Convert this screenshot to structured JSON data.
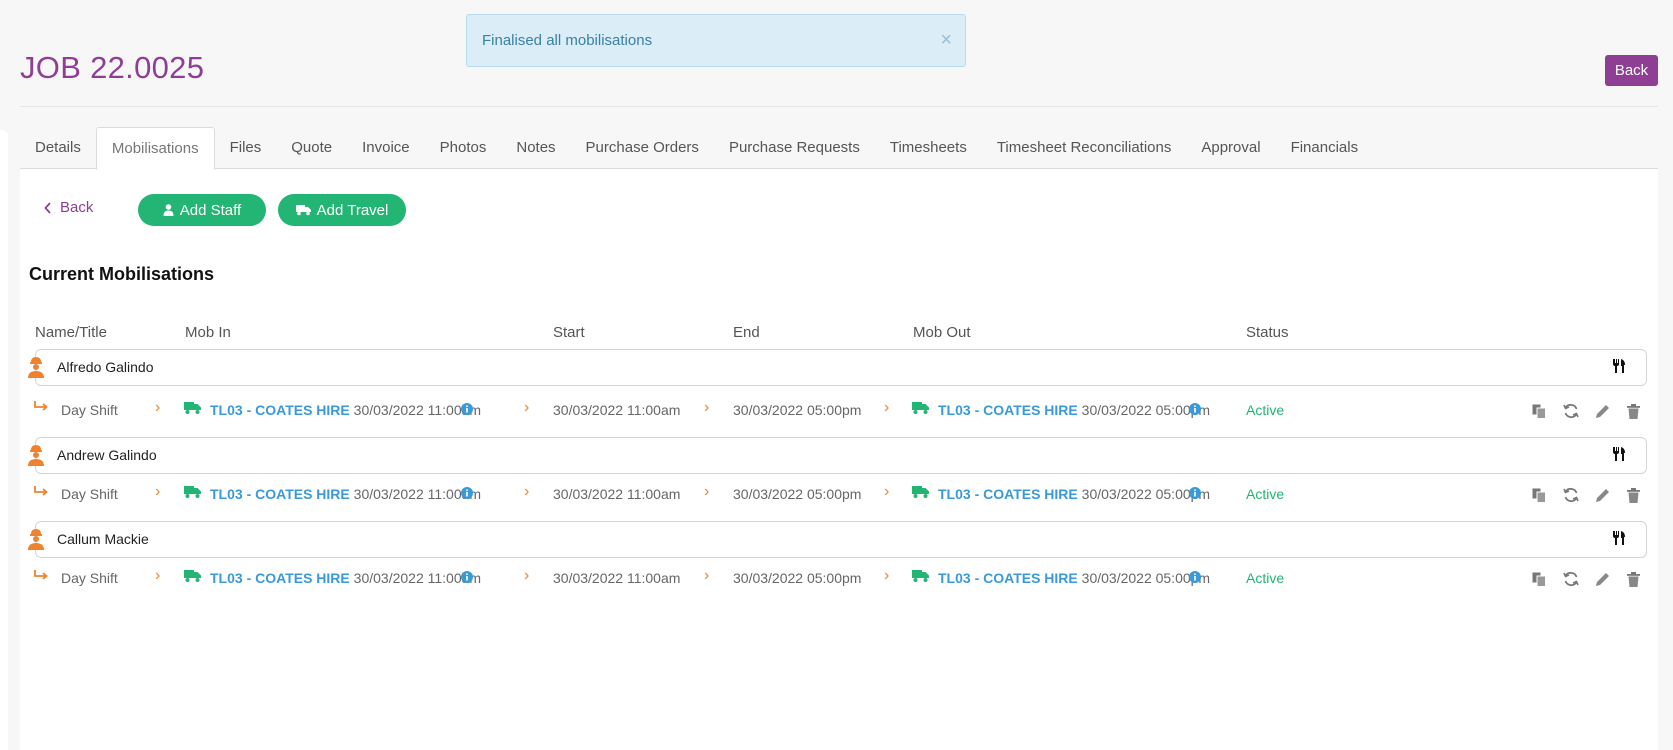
{
  "alert": {
    "message": "Finalised all mobilisations",
    "close": "×"
  },
  "header": {
    "job_title": "JOB 22.0025",
    "back_label": "Back"
  },
  "tabs": [
    "Details",
    "Mobilisations",
    "Files",
    "Quote",
    "Invoice",
    "Photos",
    "Notes",
    "Purchase Orders",
    "Purchase Requests",
    "Timesheets",
    "Timesheet Reconciliations",
    "Approval",
    "Financials"
  ],
  "active_tab": "Mobilisations",
  "toolbar": {
    "back_label": "Back",
    "add_staff_label": "Add Staff",
    "add_travel_label": "Add Travel"
  },
  "section_title": "Current Mobilisations",
  "columns": {
    "name": "Name/Title",
    "mob_in": "Mob In",
    "start": "Start",
    "end": "End",
    "mob_out": "Mob Out",
    "status": "Status"
  },
  "mobilisations": [
    {
      "name": "Alfredo Galindo",
      "shift": "Day Shift",
      "mob_in_link": "TL03 - COATES HIRE",
      "mob_in_time": "30/03/2022 11:00am",
      "start": "30/03/2022 11:00am",
      "end": "30/03/2022 05:00pm",
      "mob_out_link": "TL03 - COATES HIRE",
      "mob_out_time": "30/03/2022 05:00pm",
      "status": "Active"
    },
    {
      "name": "Andrew Galindo",
      "shift": "Day Shift",
      "mob_in_link": "TL03 - COATES HIRE",
      "mob_in_time": "30/03/2022 11:00am",
      "start": "30/03/2022 11:00am",
      "end": "30/03/2022 05:00pm",
      "mob_out_link": "TL03 - COATES HIRE",
      "mob_out_time": "30/03/2022 05:00pm",
      "status": "Active"
    },
    {
      "name": "Callum Mackie",
      "shift": "Day Shift",
      "mob_in_link": "TL03 - COATES HIRE",
      "mob_in_time": "30/03/2022 11:00am",
      "start": "30/03/2022 11:00am",
      "end": "30/03/2022 05:00pm",
      "mob_out_link": "TL03 - COATES HIRE",
      "mob_out_time": "30/03/2022 05:00pm",
      "status": "Active"
    }
  ],
  "colors": {
    "brand": "#8e3f94",
    "green": "#22b573",
    "link": "#3a9ad9",
    "orange": "#f0822d",
    "alert_bg": "#dbedf6"
  },
  "icons": {
    "person": "worker-icon",
    "meal": "fork-knife-icon",
    "shift": "arrow-turn-icon",
    "truck": "truck-icon",
    "info": "info-icon",
    "copy": "copy-icon",
    "refresh": "refresh-icon",
    "edit": "pencil-icon",
    "delete": "trash-icon"
  }
}
